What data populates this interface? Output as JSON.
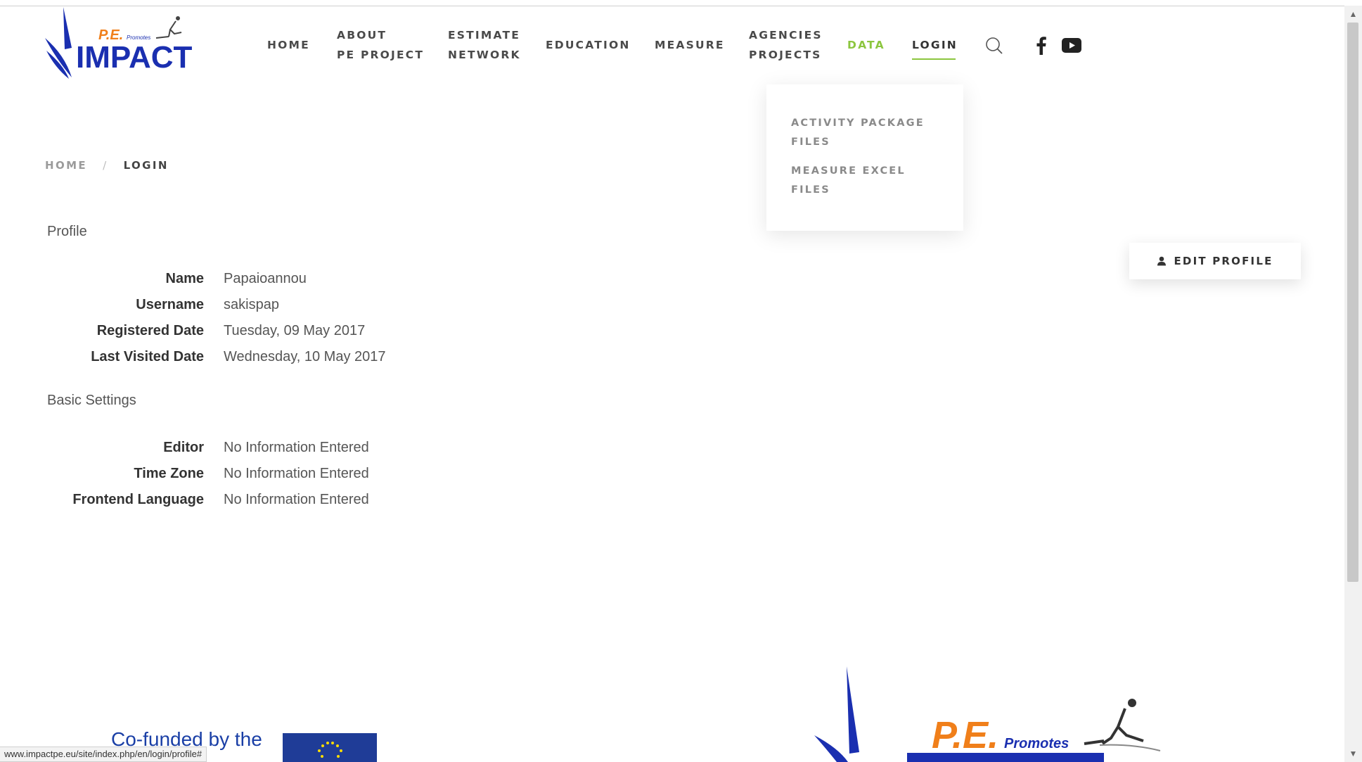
{
  "brand": {
    "logo_pe": "P.E.",
    "logo_promotes": "Promotes",
    "logo_impact": "IMPACT"
  },
  "nav": {
    "home": "HOME",
    "about_l1": "ABOUT",
    "about_l2": "PE PROJECT",
    "estimate_l1": "ESTIMATE",
    "estimate_l2": "NETWORK",
    "education": "EDUCATION",
    "measure": "MEASURE",
    "agencies_l1": "AGENCIES",
    "agencies_l2": "PROJECTS",
    "data": "DATA",
    "login": "LOGIN"
  },
  "colors": {
    "accent": "#8cc63f",
    "brand_blue": "#1a2fb0",
    "brand_orange": "#f07f1a"
  },
  "icons": [
    "search-icon",
    "facebook-icon",
    "youtube-icon",
    "user-icon"
  ],
  "dropdown": {
    "item1_l1": "ACTIVITY PACKAGE",
    "item1_l2": "FILES",
    "item2_l1": "MEASURE EXCEL",
    "item2_l2": "FILES"
  },
  "breadcrumb": {
    "home": "HOME",
    "separator": "/",
    "current": "LOGIN"
  },
  "profile": {
    "section_title": "Profile",
    "fields": [
      {
        "label": "Name",
        "value": "Papaioannou"
      },
      {
        "label": "Username",
        "value": "sakispap"
      },
      {
        "label": "Registered Date",
        "value": "Tuesday, 09 May 2017"
      },
      {
        "label": "Last Visited Date",
        "value": "Wednesday, 10 May 2017"
      }
    ]
  },
  "basic_settings": {
    "section_title": "Basic Settings",
    "fields": [
      {
        "label": "Editor",
        "value": "No Information Entered"
      },
      {
        "label": "Time Zone",
        "value": "No Information Entered"
      },
      {
        "label": "Frontend Language",
        "value": "No Information Entered"
      }
    ]
  },
  "edit_profile": {
    "label": "EDIT PROFILE"
  },
  "footer": {
    "cofunded": "Co-funded by the",
    "logo_pe": "P.E.",
    "logo_promotes": "Promotes"
  },
  "status_url": "www.impactpe.eu/site/index.php/en/login/profile#"
}
